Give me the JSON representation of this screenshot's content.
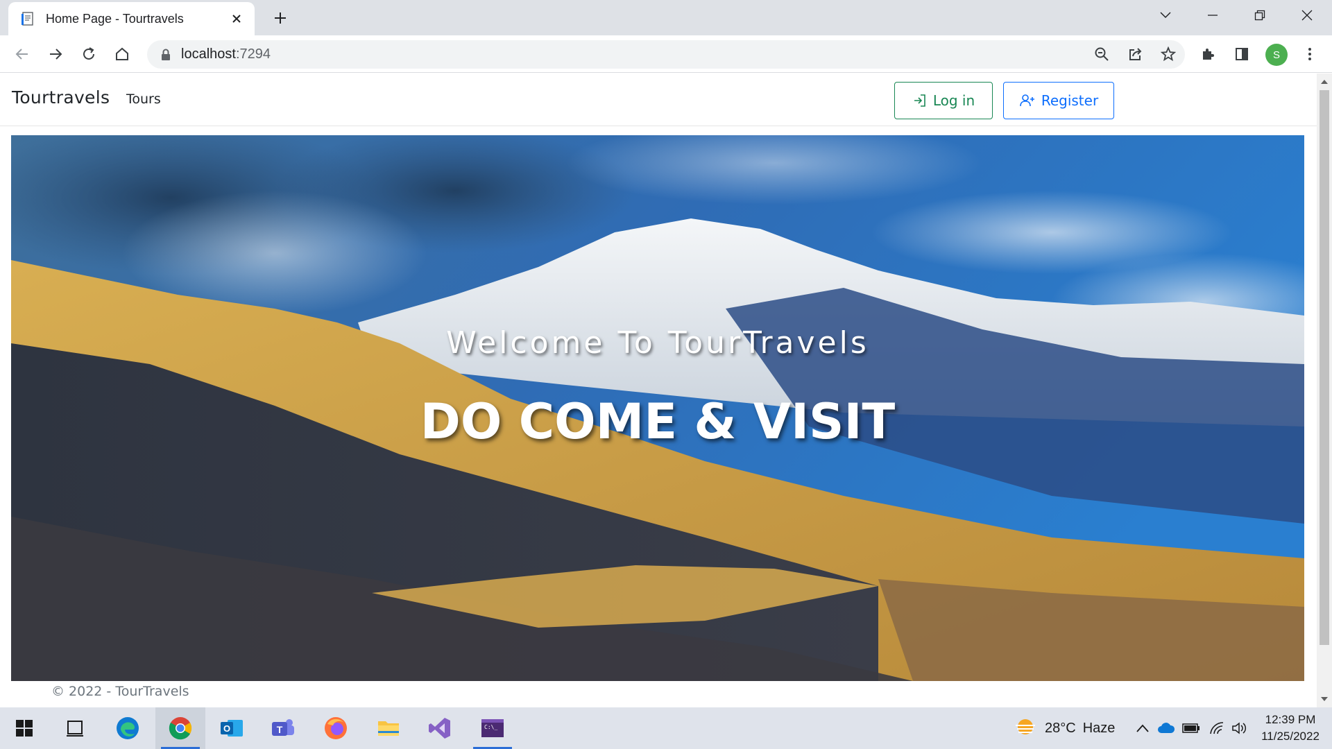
{
  "browser": {
    "tab_title": "Home Page - Tourtravels",
    "url_host": "localhost",
    "url_port": ":7294",
    "profile_initial": "S",
    "icons": [
      "favicon-doc-icon",
      "close-icon",
      "plus-icon",
      "tab-search-icon",
      "minimize-icon",
      "restore-icon",
      "window-close-icon",
      "back-icon",
      "forward-icon",
      "reload-icon",
      "home-icon",
      "lock-icon",
      "zoom-out-icon",
      "share-icon",
      "star-icon",
      "extensions-icon",
      "side-panel-icon",
      "menu-icon"
    ]
  },
  "site": {
    "brand": "Tourtravels",
    "nav_tours": "Tours",
    "login_label": "Log in",
    "register_label": "Register",
    "hero_subtitle": "Welcome To TourTravels",
    "hero_title": "DO COME & VISIT",
    "footer": "© 2022 - TourTravels",
    "colors": {
      "login": "#198754",
      "register": "#0d6efd"
    }
  },
  "taskbar": {
    "apps": [
      "windows-start-icon",
      "task-view-icon",
      "edge-icon",
      "chrome-icon",
      "outlook-icon",
      "teams-icon",
      "firefox-icon",
      "file-explorer-icon",
      "visual-studio-icon",
      "terminal-icon"
    ],
    "weather_temp": "28°C",
    "weather_text": "Haze",
    "time": "12:39 PM",
    "date": "11/25/2022"
  }
}
